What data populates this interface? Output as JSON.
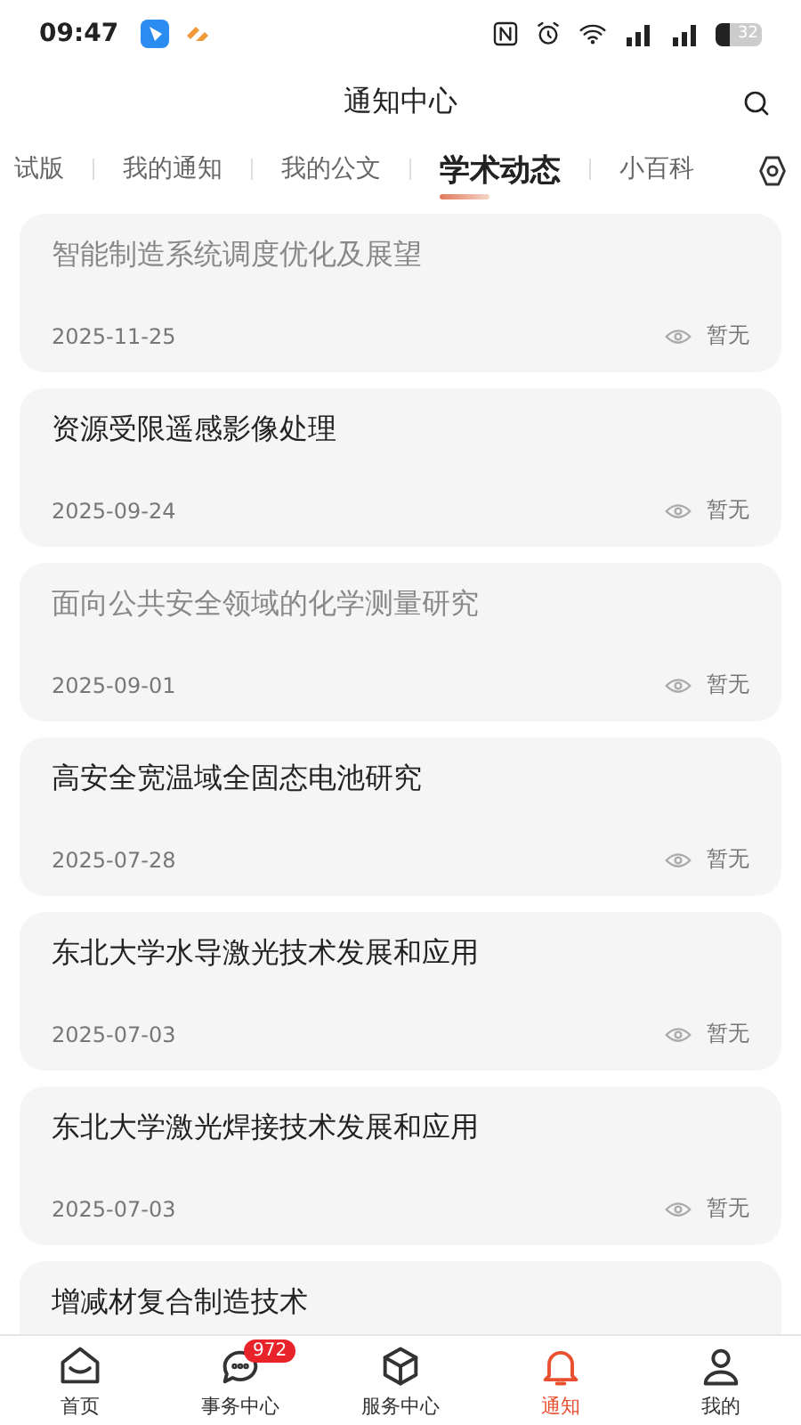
{
  "status_bar": {
    "time": "09:47",
    "battery": "32"
  },
  "header": {
    "title": "通知中心"
  },
  "tabs": [
    {
      "label": "试版",
      "selected": false
    },
    {
      "label": "我的通知",
      "selected": false
    },
    {
      "label": "我的公文",
      "selected": false
    },
    {
      "label": "学术动态",
      "selected": true
    },
    {
      "label": "小百科",
      "selected": false
    }
  ],
  "articles": [
    {
      "title": "智能制造系统调度优化及展望",
      "date": "2025-11-25",
      "views": "暂无",
      "read": true
    },
    {
      "title": "资源受限遥感影像处理",
      "date": "2025-09-24",
      "views": "暂无",
      "read": false
    },
    {
      "title": "面向公共安全领域的化学测量研究",
      "date": "2025-09-01",
      "views": "暂无",
      "read": true
    },
    {
      "title": "高安全宽温域全固态电池研究",
      "date": "2025-07-28",
      "views": "暂无",
      "read": false
    },
    {
      "title": "东北大学水导激光技术发展和应用",
      "date": "2025-07-03",
      "views": "暂无",
      "read": false
    },
    {
      "title": "东北大学激光焊接技术发展和应用",
      "date": "2025-07-03",
      "views": "暂无",
      "read": false
    },
    {
      "title": "增减材复合制造技术",
      "read": false
    }
  ],
  "bottom_nav": [
    {
      "kind": "home",
      "label": "首页",
      "selected": false
    },
    {
      "kind": "chat",
      "label": "事务中心",
      "badge": "972",
      "selected": false
    },
    {
      "kind": "cube",
      "label": "服务中心",
      "selected": false
    },
    {
      "kind": "bell",
      "label": "通知",
      "selected": true
    },
    {
      "kind": "user",
      "label": "我的",
      "selected": false
    }
  ]
}
